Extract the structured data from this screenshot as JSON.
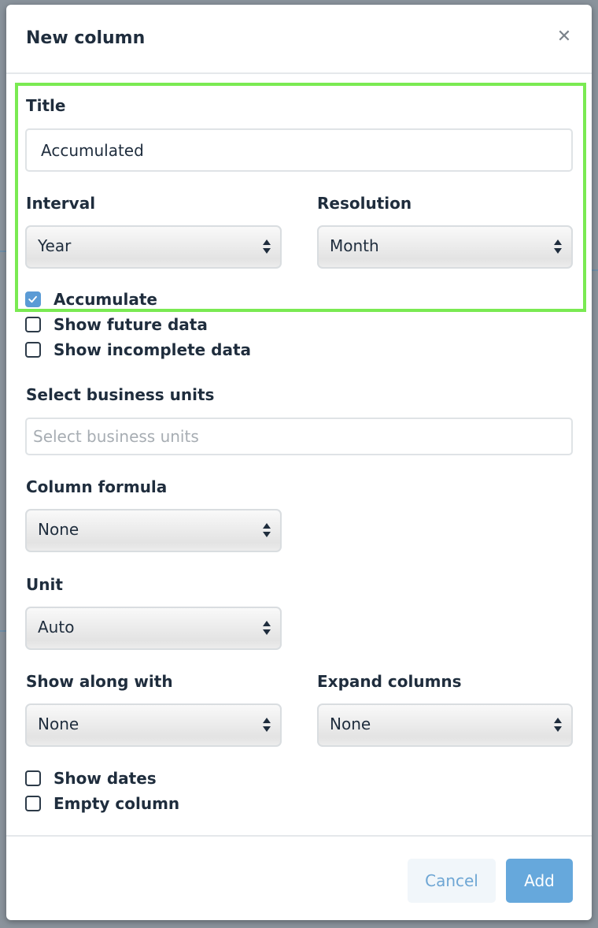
{
  "modal": {
    "title": "New column",
    "close_icon": "close-icon"
  },
  "form": {
    "title_label": "Title",
    "title_value": "Accumulated",
    "interval_label": "Interval",
    "interval_value": "Year",
    "resolution_label": "Resolution",
    "resolution_value": "Month",
    "accumulate": {
      "label": "Accumulate",
      "checked": true
    },
    "show_future_data": {
      "label": "Show future data",
      "checked": false
    },
    "show_incomplete_data": {
      "label": "Show incomplete data",
      "checked": false
    },
    "business_units_label": "Select business units",
    "business_units_placeholder": "Select business units",
    "column_formula_label": "Column formula",
    "column_formula_value": "None",
    "unit_label": "Unit",
    "unit_value": "Auto",
    "show_along_with_label": "Show along with",
    "show_along_with_value": "None",
    "expand_columns_label": "Expand columns",
    "expand_columns_value": "None",
    "show_dates": {
      "label": "Show dates",
      "checked": false
    },
    "empty_column": {
      "label": "Empty column",
      "checked": false
    }
  },
  "footer": {
    "cancel_label": "Cancel",
    "add_label": "Add"
  },
  "colors": {
    "highlight": "#7aea52",
    "primary": "#66a8dc",
    "checkbox_checked": "#5b9bd5"
  }
}
